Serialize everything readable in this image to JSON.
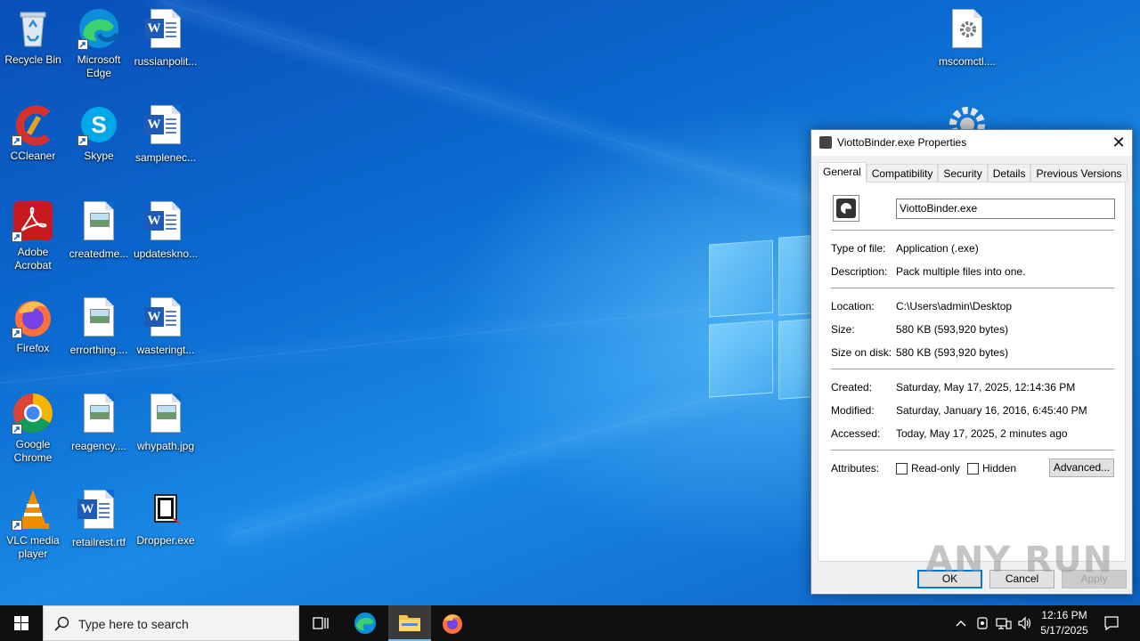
{
  "desktop": {
    "icons": [
      {
        "label": "Recycle Bin"
      },
      {
        "label": "Microsoft\nEdge"
      },
      {
        "label": "russianpolit..."
      },
      {
        "label": "CCleaner"
      },
      {
        "label": "Skype"
      },
      {
        "label": "samplenec..."
      },
      {
        "label": "Adobe\nAcrobat"
      },
      {
        "label": "createdme..."
      },
      {
        "label": "updateskno..."
      },
      {
        "label": "Firefox"
      },
      {
        "label": "errorthing...."
      },
      {
        "label": "wasteringt..."
      },
      {
        "label": "Google\nChrome"
      },
      {
        "label": "reagency...."
      },
      {
        "label": "whypath.jpg"
      },
      {
        "label": "VLC media\nplayer"
      },
      {
        "label": "retailrest.rtf"
      },
      {
        "label": "Dropper.exe"
      },
      {
        "label": "mscomctl...."
      }
    ]
  },
  "dialog": {
    "title": "ViottoBinder.exe Properties",
    "tabs": [
      "General",
      "Compatibility",
      "Security",
      "Details",
      "Previous Versions"
    ],
    "active_tab": "General",
    "file_name": "ViottoBinder.exe",
    "fields": {
      "type_label": "Type of file:",
      "type_value": "Application (.exe)",
      "desc_label": "Description:",
      "desc_value": "Pack multiple files into one.",
      "loc_label": "Location:",
      "loc_value": "C:\\Users\\admin\\Desktop",
      "size_label": "Size:",
      "size_value": "580 KB (593,920 bytes)",
      "disk_label": "Size on disk:",
      "disk_value": "580 KB (593,920 bytes)",
      "created_label": "Created:",
      "created_value": "Saturday, May 17, 2025, 12:14:36 PM",
      "modified_label": "Modified:",
      "modified_value": "Saturday, January 16, 2016, 6:45:40 PM",
      "accessed_label": "Accessed:",
      "accessed_value": "Today, May 17, 2025, 2 minutes ago",
      "attr_label": "Attributes:"
    },
    "readonly_label": "Read-only",
    "hidden_label": "Hidden",
    "advanced_label": "Advanced...",
    "ok_label": "OK",
    "cancel_label": "Cancel",
    "apply_label": "Apply",
    "watermark": "ANY RUN"
  },
  "taskbar": {
    "search_placeholder": "Type here to search",
    "time": "12:16 PM",
    "date": "5/17/2025"
  }
}
